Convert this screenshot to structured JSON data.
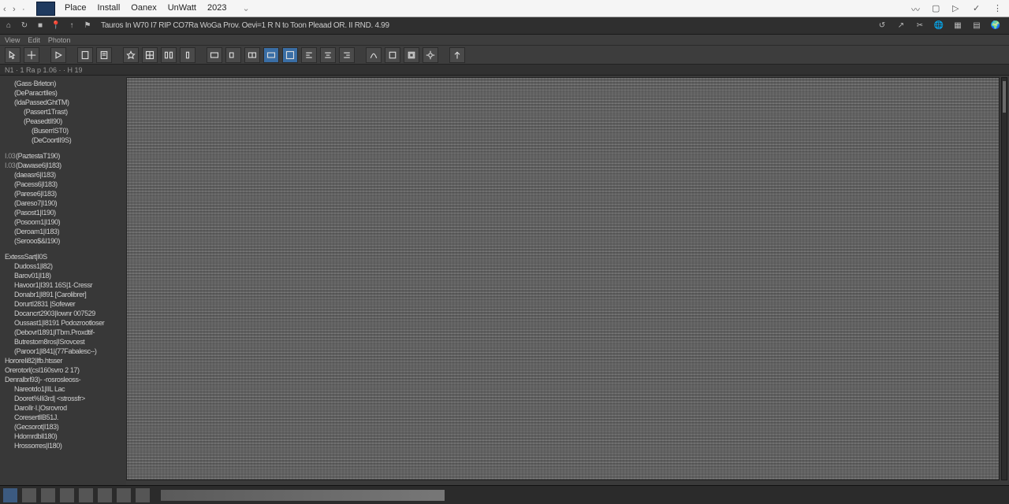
{
  "menu": {
    "items": [
      "Place",
      "Install",
      "Oanex",
      "UnWatt",
      "2023"
    ]
  },
  "titlebar_nav": {
    "back": "‹",
    "fwd": "›",
    "up": "·"
  },
  "pathbar": {
    "crumb": "Tauros In W70 I7 RIP CO7Ra WoGa Prov. Oevi=1 R N to Toon Pleaad   OR. II RND. 4.99"
  },
  "ribbon_tabs": [
    "View",
    "Edit",
    "Photon"
  ],
  "substatus": "N1 · 1 Ra p 1.06 · · H 19",
  "outline": {
    "group1": [
      "(Gass·Brleton)",
      "(DeParacrtIles)",
      "(IdaPassedGhtTM)",
      "(Passert1Trast)",
      "(PeasedtII90)",
      "(BuserrIST0)",
      "(DeCoortII9S)"
    ],
    "group2_prefix": [
      "I.03",
      "I.03"
    ],
    "group2": [
      "(PaztestaT190)",
      "(Dawase6|I183)",
      "(daeasr6|I183)",
      "(Pacess6|I183)",
      "(Parese6|I183)",
      "(Dareso7|I190)",
      "(Pasost1|I190)",
      "(Posoom1|I190)",
      "(Deroam1|I183)",
      "(Serooo$&I190)"
    ],
    "group3": [
      "ExtessSart|I0S",
      "Dudoss1|I82)",
      "Barov01|I18)",
      "Havoor1|I391 16S|1·Cressr",
      "Donabr1|I891 [Carolibrer]",
      "DorurtI2831 |Sofewer",
      "Docancrt2903|Iownr  007529",
      "Oussast1|I8191  Podozrootloser",
      "(Debovrl1891|ITbm.Proxdtif-",
      "Butrestorn8ros|ISrovcest",
      "(Paroor1|I841|{77Fabalesc--)",
      "HororeIi82|Ifb.htsser",
      "Orerotorl(csI160svro 2 17)",
      "Denralbrl93)-  -rosrosleoss-",
      "Nareotdo1|IIL Lac",
      "Dooret%IIi3rd|   <strossfr>",
      "DaroIlr·I.|Osrovrod",
      "CoresertlIB51J.",
      "(Gecsorot|I183)",
      "HdomrdblI180)",
      "Hrossorres|I180)"
    ]
  },
  "footer": {
    "status": ""
  }
}
